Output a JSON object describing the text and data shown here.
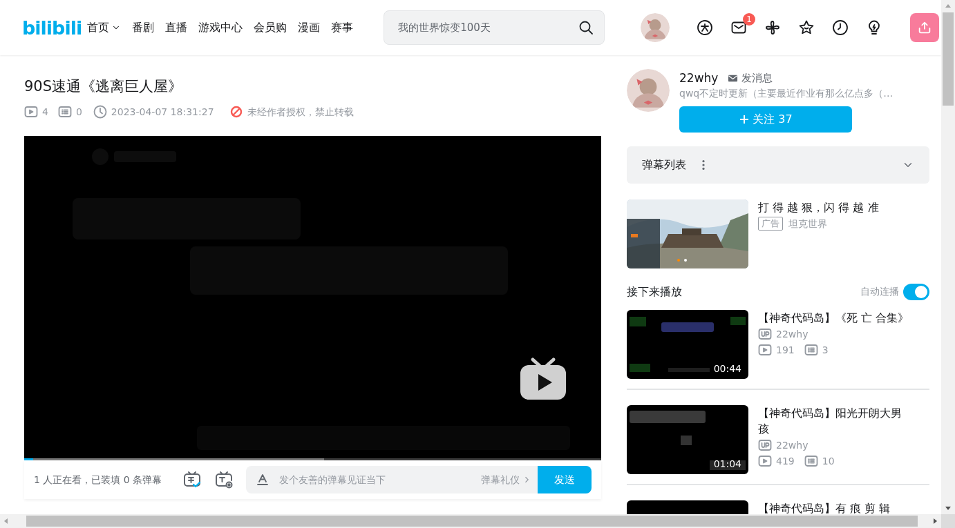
{
  "header": {
    "logo": "bilibili",
    "nav": [
      {
        "label": "首页",
        "has_menu": true
      },
      {
        "label": "番剧",
        "has_menu": false
      },
      {
        "label": "直播",
        "has_menu": false
      },
      {
        "label": "游戏中心",
        "has_menu": false
      },
      {
        "label": "会员购",
        "has_menu": false
      },
      {
        "label": "漫画",
        "has_menu": false
      },
      {
        "label": "赛事",
        "has_menu": false
      }
    ],
    "search": {
      "placeholder": "我的世界惊变100天"
    },
    "message_badge": "1"
  },
  "video": {
    "title": "90S速通《逃离巨人屋》",
    "views": "4",
    "danmaku_count": "0",
    "date": "2023-04-07 18:31:27",
    "copyright": "未经作者授权，禁止转载",
    "progress": {
      "level": 0.015
    },
    "watching": "1 人正在看，已装填 0 条弹幕",
    "danmaku_input": {
      "placeholder": "发个友善的弹幕见证当下",
      "etiquette": "弹幕礼仪",
      "send": "发送"
    }
  },
  "uploader": {
    "name": "22why",
    "message": "发消息",
    "description": "qwq不定时更新（主要最近作业有那么亿点多（…",
    "follow": "关注 37"
  },
  "danmaku_list": {
    "title": "弹幕列表"
  },
  "ad": {
    "title": "打 得 越 狠，闪 得 越 准",
    "tag": "广告",
    "sponsor": "坦克世界"
  },
  "up_next": {
    "title": "接下来播放",
    "autoplay_label": "自动连播",
    "autoplay_on": true,
    "items": [
      {
        "title": "【神奇代码岛】《死 亡 合集》",
        "duration": "00:44",
        "uploader": "22why",
        "views": "191",
        "danmaku": "3"
      },
      {
        "title": "【神奇代码岛】阳光开朗大男孩",
        "duration": "01:04",
        "uploader": "22why",
        "views": "419",
        "danmaku": "10"
      },
      {
        "title": "【神奇代码岛】有 痕 剪 辑"
      }
    ]
  }
}
